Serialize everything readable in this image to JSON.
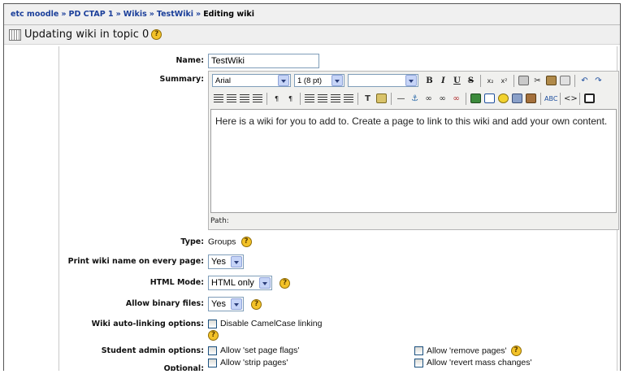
{
  "breadcrumb": {
    "items": [
      "etc moodle",
      "PD CTAP 1",
      "Wikis",
      "TestWiki"
    ],
    "separator": "»",
    "current": "Editing wiki"
  },
  "heading": {
    "title": "Updating wiki in topic 0",
    "help": "?"
  },
  "form": {
    "name": {
      "label": "Name:",
      "value": "TestWiki"
    },
    "summary": {
      "label": "Summary:",
      "font_family": "Arial",
      "font_size": "1 (8 pt)",
      "format_value": "",
      "content": "Here is a wiki for you to add to. Create a page to link to this wiki and add your own content.",
      "path_label": "Path:"
    },
    "type": {
      "label": "Type:",
      "value": "Groups"
    },
    "print_name": {
      "label": "Print wiki name on every page:",
      "value": "Yes"
    },
    "html_mode": {
      "label": "HTML Mode:",
      "value": "HTML only"
    },
    "binary_files": {
      "label": "Allow binary files:",
      "value": "Yes"
    },
    "autolinking": {
      "label": "Wiki auto-linking options:",
      "option": "Disable CamelCase linking"
    },
    "student_admin": {
      "label": "Student admin options:",
      "options": [
        "Allow 'set page flags'",
        "Allow 'remove pages'",
        "Allow 'strip pages'",
        "Allow 'revert mass changes'"
      ]
    },
    "optional": {
      "label": "Optional:"
    }
  },
  "toolbar": {
    "bold": "B",
    "italic": "I",
    "underline": "U",
    "strike": "S",
    "subscript": "x₂",
    "superscript": "x²",
    "ltr": "¶",
    "rtl": "¶",
    "rule": "—",
    "spell": "ABC",
    "html": "<>"
  },
  "colors": {
    "breadcrumb_link": "#1b3f9a",
    "help_icon": "#f3c228",
    "select_arrow": "#c6d4f7",
    "input_border": "#7f9db9"
  }
}
